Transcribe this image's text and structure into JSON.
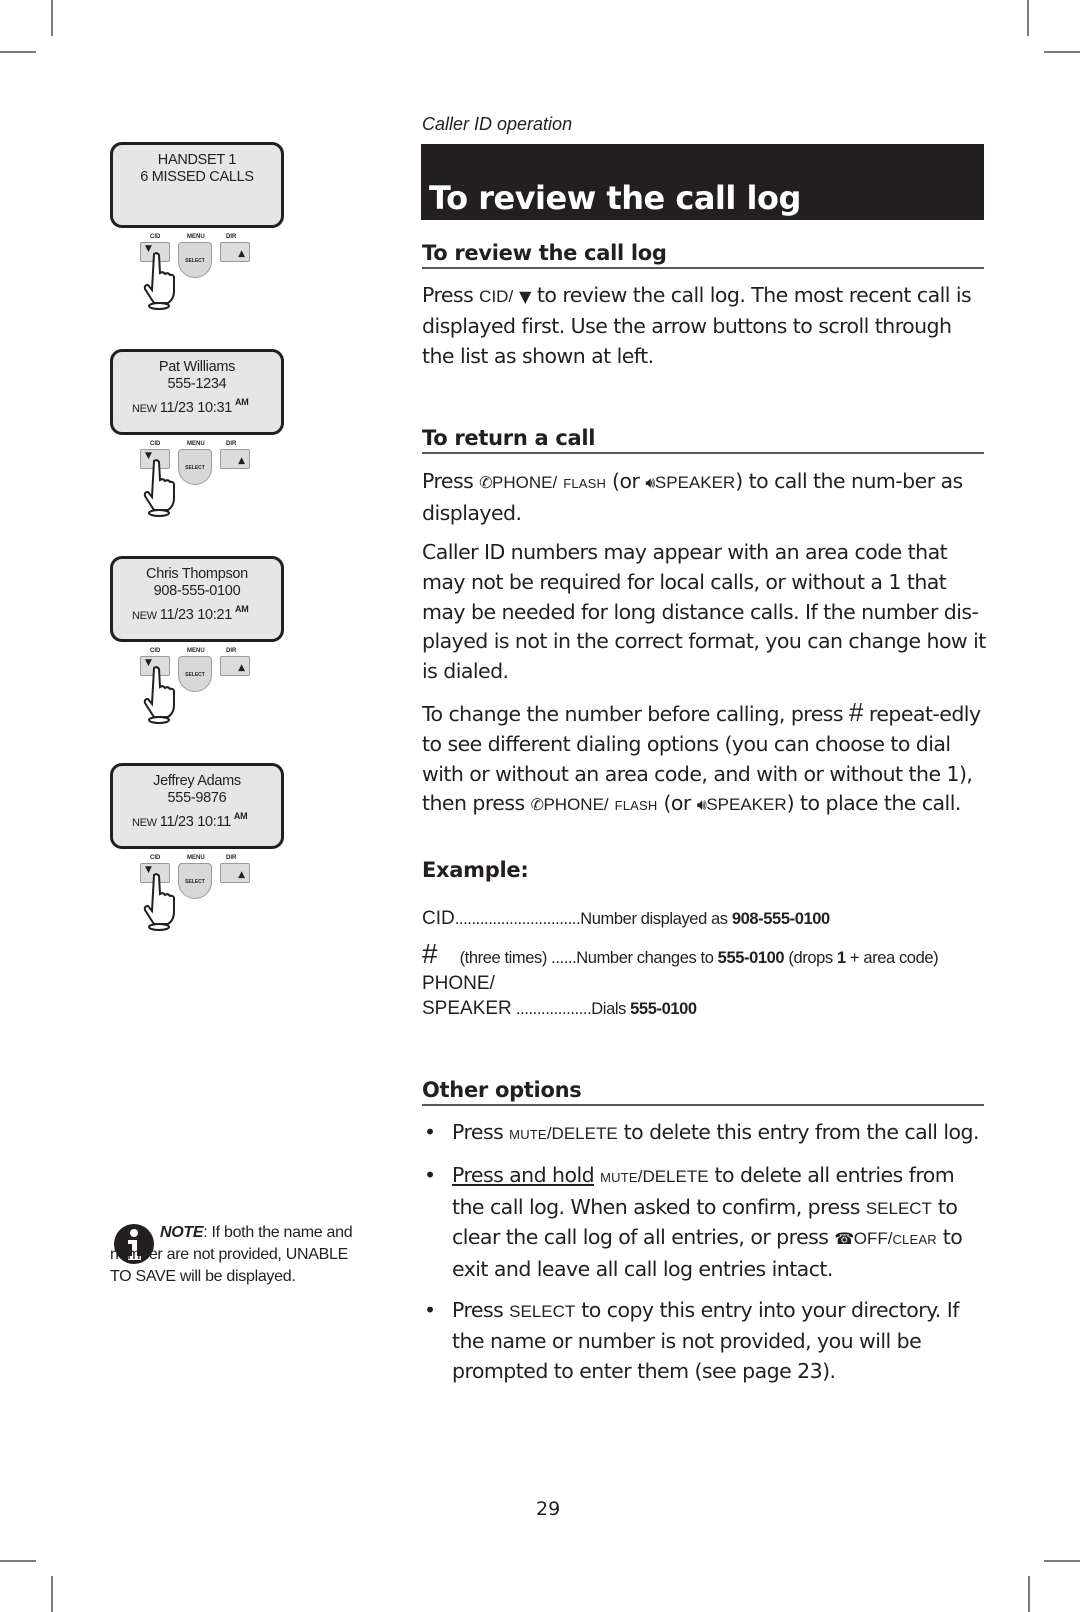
{
  "header": {
    "running_title": "Caller ID operation"
  },
  "banner": {
    "title": "To review the call log"
  },
  "left_column": {
    "screens": [
      {
        "line1": "HANDSET 1",
        "line2": "6 MISSED CALLS"
      },
      {
        "line1": "Pat Williams",
        "line2": "555-1234",
        "new": "NEW",
        "datetime": "11/23 10:31",
        "ampm": "AM"
      },
      {
        "line1": "Chris Thompson",
        "line2": "908-555-0100",
        "new": "NEW",
        "datetime": "11/23 10:21",
        "ampm": "AM"
      },
      {
        "line1": "Jeffrey Adams",
        "line2": "555-9876",
        "new": "NEW",
        "datetime": "11/23 10:11",
        "ampm": "AM"
      }
    ],
    "keypad": {
      "cid": "CID",
      "menu": "MENU",
      "dir": "DIR",
      "select": "SELECT",
      "down": "▼",
      "up": "▲"
    },
    "note": {
      "label": "NOTE",
      "text": ": If both the name and number are not provided, UNABLE TO SAVE will be displayed."
    }
  },
  "sections": {
    "review": {
      "heading": "To review the call log",
      "p1_a": "Press ",
      "p1_key": "CID/",
      "p1_arrow": "▼",
      "p1_b": " to review the call log.  The most recent call is displayed first. Use the arrow buttons to scroll through the list as shown at left."
    },
    "return": {
      "heading": "To return a call",
      "p1_a": "Press ",
      "phone_key": "PHONE/",
      "flash_key": "FLASH",
      "p1_or": " (or ",
      "speaker_key": "SPEAKER",
      "p1_b": ") to call the num-ber as displayed.",
      "p2": "Caller ID numbers may appear with an area code that may not be required for local calls, or without a 1 that may be needed for long distance calls. If the number dis-played is not in the correct format, you can change how it is dialed.",
      "p3_a": "To change the number before calling, press ",
      "p3_hash": "#",
      "p3_b": "  repeat-edly to see different dialing options (you can choose to dial with or without an area code, and with or without the 1), then press ",
      "p3_or": " (or ",
      "p3_c": ") to place the call."
    },
    "example": {
      "heading": "Example:",
      "rows": [
        {
          "key": "CID",
          "extra": "",
          "dots": "..............................",
          "desc": "Number displayed as ",
          "bold": "908-555-0100",
          "tail": ""
        },
        {
          "key": "#",
          "extra": "(three times)",
          "dots": " ......",
          "desc": "Number changes to ",
          "bold": "555-0100",
          "tail": " (drops ",
          "bold2": "1",
          "tail2": " + area code)"
        },
        {
          "key": "PHONE/",
          "extra": "",
          "dots": "",
          "desc": "",
          "bold": "",
          "tail": ""
        },
        {
          "key": "SPEAKER",
          "extra": "",
          "dots": " ..................",
          "desc": "Dials ",
          "bold": "555-0100",
          "tail": ""
        }
      ]
    },
    "other": {
      "heading": "Other options",
      "bullets": [
        {
          "pre": "Press ",
          "mute": "MUTE",
          "del": "/DELETE",
          "post": "  to delete this entry from the call log."
        },
        {
          "underline": "Press and hold",
          "mute": "MUTE",
          "del": "/DELETE",
          "mid": "  to delete all entries from the call log. When asked to confirm, press ",
          "select": "SELECT",
          "mid2": "  to clear the call log of all entries, or press ",
          "off": "OFF/",
          "clear": "CLEAR",
          "post": " to exit and leave all call log entries intact."
        },
        {
          "pre": "Press ",
          "select": "SELECT",
          "post": "  to copy this entry into your directory. If the name or number is not provided, you will be prompted to enter them (see page 23)."
        }
      ]
    }
  },
  "footer": {
    "page_number": "29"
  }
}
